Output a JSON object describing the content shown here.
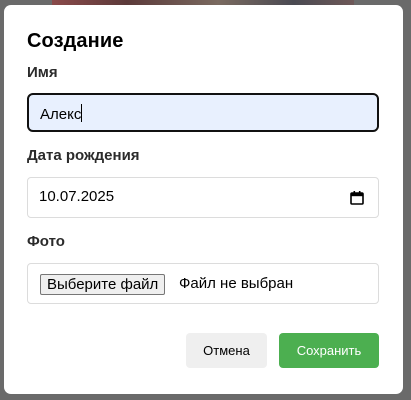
{
  "dialog": {
    "title": "Создание",
    "name": {
      "label": "Имя",
      "value": "Алекс"
    },
    "birthdate": {
      "label": "Дата рождения",
      "value": "10.07.2025"
    },
    "photo": {
      "label": "Фото",
      "button_label": "Выберите файл",
      "status": "Файл не выбран"
    },
    "actions": {
      "cancel_label": "Отмена",
      "save_label": "Сохранить"
    }
  },
  "icons": {
    "date_picker": "calendar-icon"
  },
  "colors": {
    "focused_field_bg": "#e8f0fe",
    "focused_field_border": "#111111",
    "save_button_bg": "#4caf50",
    "cancel_button_bg": "#efefef",
    "overlay": "#6a6a6a"
  }
}
